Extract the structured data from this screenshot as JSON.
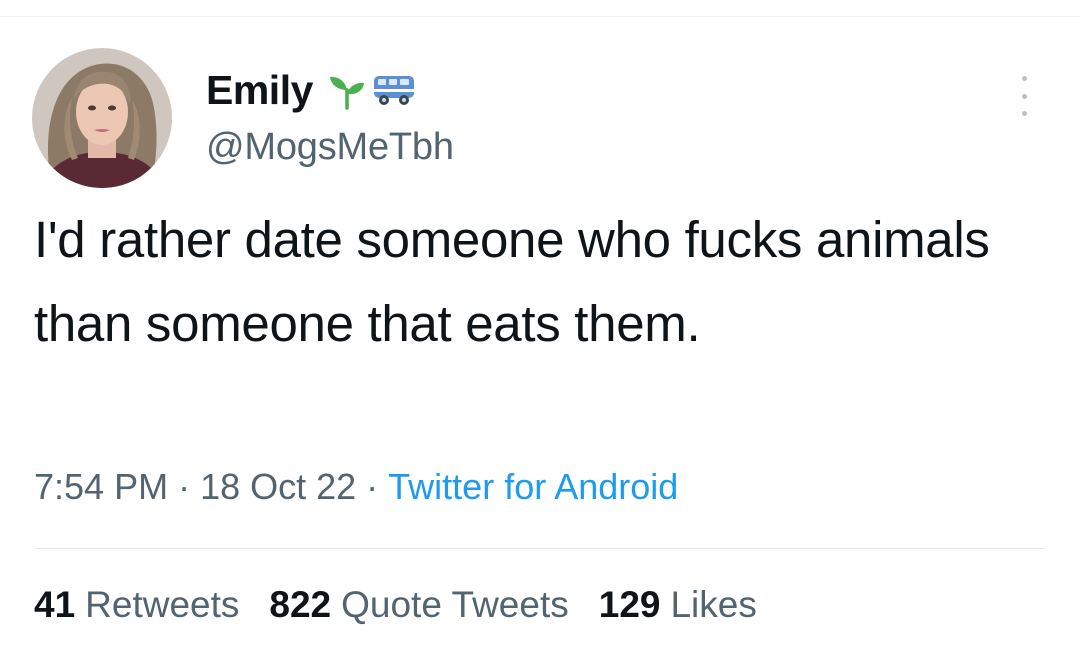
{
  "tweet": {
    "author": {
      "display_name": "Emily",
      "handle": "@MogsMeTbh",
      "badges": [
        "sprout-icon",
        "van-icon"
      ]
    },
    "text": "I'd rather date someone who fucks animals than someone that eats them.",
    "time": "7:54 PM",
    "date": "18 Oct 22",
    "source": "Twitter for Android",
    "separator": "·",
    "stats": {
      "retweets": {
        "count": "41",
        "label": "Retweets"
      },
      "quote_tweets": {
        "count": "822",
        "label": "Quote Tweets"
      },
      "likes": {
        "count": "129",
        "label": "Likes"
      }
    }
  },
  "colors": {
    "text_primary": "#0f1419",
    "text_secondary": "#536471",
    "link": "#1d9bf0",
    "sprout": "#4caf50",
    "van": "#5b8fd6"
  }
}
